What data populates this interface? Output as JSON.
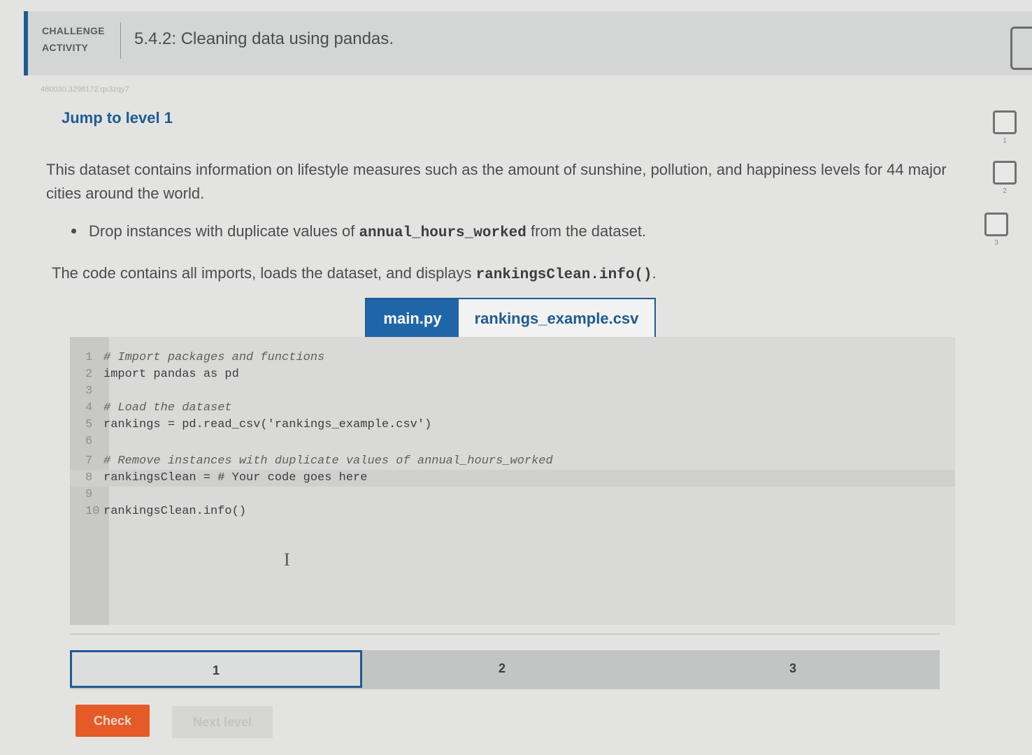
{
  "header": {
    "badge_line1": "CHALLENGE",
    "badge_line2": "ACTIVITY",
    "title": "5.4.2: Cleaning data using pandas."
  },
  "subtitle": "480030.3298172.qx3zqy7",
  "jump_label": "Jump to level 1",
  "description": "This dataset contains information on lifestyle measures such as the amount of sunshine, pollution, and happiness levels for 44 major cities around the world.",
  "bullet": {
    "before": "Drop instances with duplicate values of ",
    "code": "annual_hours_worked",
    "after": " from the dataset."
  },
  "code_note": {
    "before": "The code contains all imports, loads the dataset, and displays ",
    "code": "rankingsClean.info()",
    "after": "."
  },
  "tabs": [
    "main.py",
    "rankings_example.csv"
  ],
  "code_lines": [
    {
      "num": "1",
      "text": "# Import packages and functions",
      "type": "comment"
    },
    {
      "num": "2",
      "text": "import pandas as pd",
      "type": "code"
    },
    {
      "num": "3",
      "text": "",
      "type": "code"
    },
    {
      "num": "4",
      "text": "# Load the dataset",
      "type": "comment"
    },
    {
      "num": "5",
      "text": "rankings = pd.read_csv('rankings_example.csv')",
      "type": "code"
    },
    {
      "num": "6",
      "text": "",
      "type": "code"
    },
    {
      "num": "7",
      "text": "# Remove instances with duplicate values of annual_hours_worked",
      "type": "comment"
    },
    {
      "num": "8",
      "text": "rankingsClean = # Your code goes here",
      "type": "code"
    },
    {
      "num": "9",
      "text": "",
      "type": "code"
    },
    {
      "num": "10",
      "text": "rankingsClean.info()",
      "type": "code"
    }
  ],
  "levels": [
    "1",
    "2",
    "3"
  ],
  "buttons": {
    "check": "Check",
    "next": "Next level"
  },
  "side_levels": [
    "1",
    "2",
    "3"
  ],
  "colors": {
    "accent": "#1f5b93",
    "tab_active": "#1f66a9",
    "check": "#e55a26"
  },
  "icons": {
    "cursor": "text-cursor-icon"
  }
}
